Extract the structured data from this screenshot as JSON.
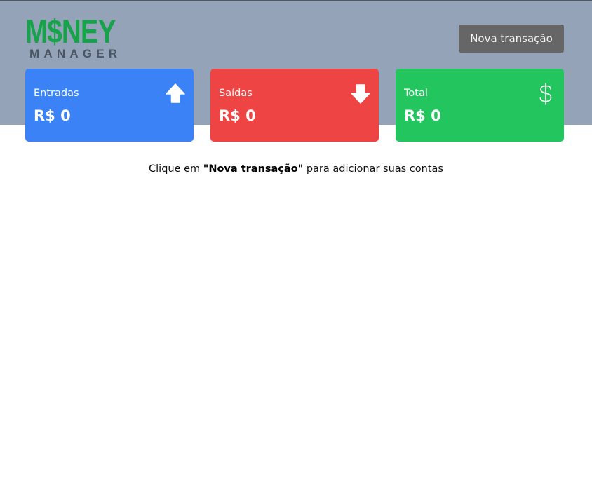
{
  "logo": {
    "word_start": "M",
    "word_dollar": "$",
    "word_end": "NEY",
    "subtitle": "MANAGER"
  },
  "header": {
    "new_transaction_label": "Nova transação"
  },
  "cards": {
    "income": {
      "label": "Entradas",
      "value": "R$ 0",
      "icon": "arrow-up-icon",
      "color": "#3b82f6"
    },
    "expense": {
      "label": "Saídas",
      "value": "R$ 0",
      "icon": "arrow-down-icon",
      "color": "#ef4444"
    },
    "total": {
      "label": "Total",
      "value": "R$ 0",
      "icon": "dollar-icon",
      "color": "#22c55e"
    }
  },
  "empty_state": {
    "prefix": "Clique em ",
    "highlight": "\"Nova transação\"",
    "suffix": " para adicionar suas contas"
  },
  "colors": {
    "header_bg": "#94a3b8",
    "logo_green": "#16a34a",
    "logo_gray": "#4b5563",
    "button_bg": "#666666"
  }
}
